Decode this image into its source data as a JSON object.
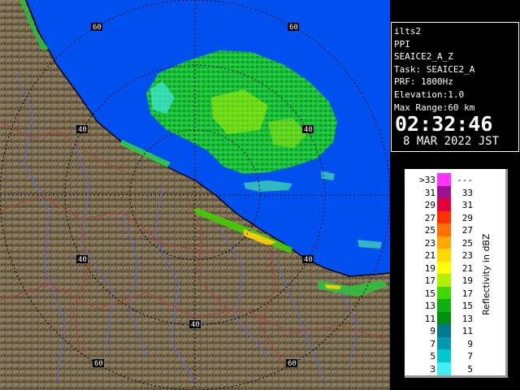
{
  "product": {
    "radar": "ilts2",
    "scan_type": "PPI",
    "product_name": "SEAICE2_A_Z",
    "task": "Task: SEAICE2_A",
    "prf": "PRF: 1800Hz",
    "elevation": "Elevation:1.0",
    "max_range": "Max Range:60 km",
    "time": "02:32:46",
    "date": "8 MAR 2022 JST"
  },
  "range_ring_labels": [
    "40",
    "60"
  ],
  "legend": {
    "title": "Reflectivity in dBZ",
    "rows": [
      {
        "low": ">33",
        "high": "---",
        "color": "#ff33ff"
      },
      {
        "low": "31",
        "high": "33",
        "color": "#a01090"
      },
      {
        "low": "29",
        "high": "31",
        "color": "#e0003c"
      },
      {
        "low": "27",
        "high": "29",
        "color": "#ff3000"
      },
      {
        "low": "25",
        "high": "27",
        "color": "#ff7000"
      },
      {
        "low": "23",
        "high": "25",
        "color": "#ffa800"
      },
      {
        "low": "21",
        "high": "23",
        "color": "#ffd800"
      },
      {
        "low": "19",
        "high": "21",
        "color": "#ffff00"
      },
      {
        "low": "17",
        "high": "19",
        "color": "#b0f000"
      },
      {
        "low": "15",
        "high": "17",
        "color": "#40d800"
      },
      {
        "low": "13",
        "high": "15",
        "color": "#10b010"
      },
      {
        "low": "11",
        "high": "13",
        "color": "#009010"
      },
      {
        "low": "9",
        "high": "11",
        "color": "#007890"
      },
      {
        "low": "7",
        "high": "9",
        "color": "#0098b0"
      },
      {
        "low": "5",
        "high": "7",
        "color": "#00c8d0"
      },
      {
        "low": "3",
        "high": "5",
        "color": "#40f0f0"
      }
    ]
  },
  "colors": {
    "sea": "#0050f0",
    "land": "#7a6a50",
    "range_ring": "#000000",
    "river": "#5a6acf",
    "boundary": "#b04040",
    "coastline": "#000000"
  }
}
